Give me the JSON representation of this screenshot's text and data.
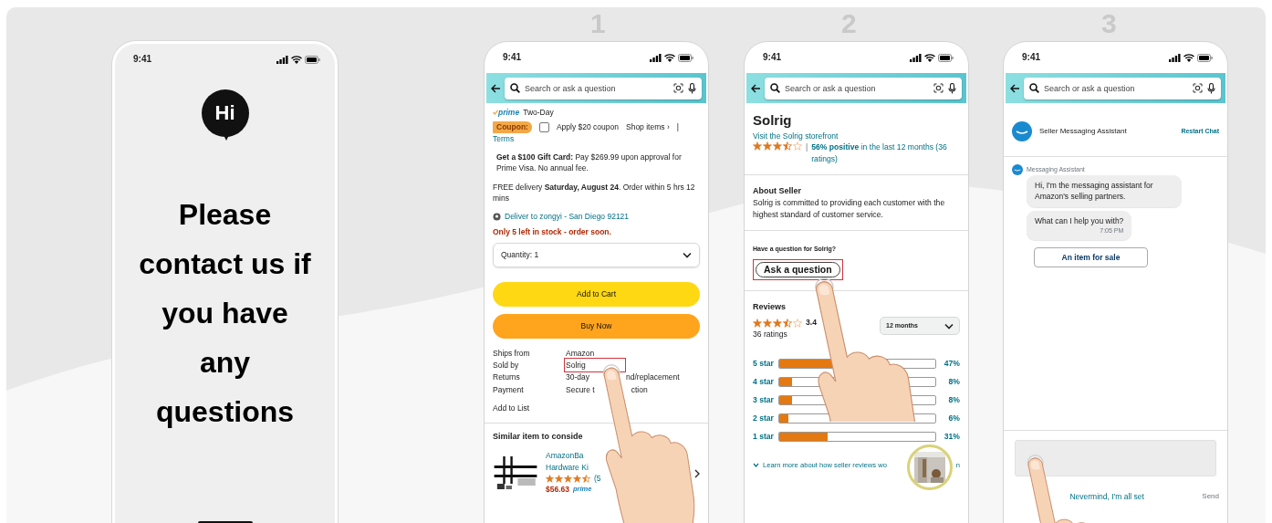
{
  "step_numbers": [
    "1",
    "2",
    "3"
  ],
  "phones": [
    {
      "kind": "message",
      "status_time": "9:41",
      "logo_text": "Hi",
      "message": "Please contact us if you have any questions"
    },
    {
      "kind": "product",
      "status_time": "9:41",
      "search_placeholder": "Search or ask a question",
      "prime_label": "prime",
      "delivery_speed": "Two-Day",
      "coupon": {
        "badge": "Coupon:",
        "checked": false,
        "label": "Apply $20 coupon",
        "link": "Shop items ›",
        "separator": "|",
        "terms": "Terms"
      },
      "gift_card": "**Get a $100 Gift Card:** Pay $269.99 upon approval for Prime Visa. No annual fee.",
      "delivery": "FREE delivery **Saturday, August 24**. Order within 5 hrs 12 mins",
      "deliver_to": "Deliver to zongyi - San Diego 92121",
      "stock": "Only 5 left in stock - order soon.",
      "quantity": "Quantity: 1",
      "buttons": [
        {
          "label": "Add to Cart",
          "kind": "cart"
        },
        {
          "label": "Buy Now",
          "kind": "buy"
        }
      ],
      "details": [
        {
          "label": "Ships from",
          "value": "Amazon",
          "highlighted": false
        },
        {
          "label": "Sold by",
          "value": "Solrig",
          "highlighted": true
        },
        {
          "label": "Returns",
          "value": "30-day",
          "value_tail": "nd/replacement",
          "highlighted": false
        },
        {
          "label": "Payment",
          "value": "Secure t",
          "value_tail": "ction",
          "highlighted": false
        }
      ],
      "add_to_list": "Add to List",
      "similar_heading": "Similar item to conside",
      "similar": {
        "title_lines": [
          "AmazonBa",
          "Hardware Ki"
        ],
        "stars": 4.5,
        "rating_count": "(5",
        "price": "$56.63",
        "prime_label": "prime"
      }
    },
    {
      "kind": "seller",
      "status_time": "9:41",
      "search_placeholder": "Search or ask a question",
      "title": "Solrig",
      "storefront": "Visit the Solrig storefront",
      "stars": 3.5,
      "separator": "|",
      "positive": "**56% positive** in the last 12 months (36 ratings)",
      "about_heading": "About Seller",
      "about": "Solrig is committed to providing each customer with the highest standard of customer service.",
      "question_prompt": "Have a question for Solrig?",
      "ask_button": "Ask a question",
      "ask_highlighted": true,
      "reviews_heading": "Reviews",
      "review": {
        "stars": 3.5
      },
      "rating": "3.4",
      "ratings_count": "36 ratings",
      "period": "12 months",
      "bars": [
        {
          "label": "5 star",
          "level": 0.47,
          "percent": "47%"
        },
        {
          "label": "4 star",
          "level": 0.08,
          "percent": "8%"
        },
        {
          "label": "3 star",
          "level": 0.08,
          "percent": "8%"
        },
        {
          "label": "2 star",
          "level": 0.06,
          "percent": "6%"
        },
        {
          "label": "1 star",
          "level": 0.31,
          "percent": "31%"
        }
      ],
      "learn_more": "Learn more about how seller reviews wo",
      "learn_more_tail": "n"
    },
    {
      "kind": "chat",
      "status_time": "9:41",
      "search_placeholder": "Search or ask a question",
      "assistant_name": "Seller Messaging Assistant",
      "restart": "Restart Chat",
      "sender": "Messaging Assistant",
      "messages": [
        {
          "text": "Hi, I'm the messaging assistant for Amazon's selling partners."
        },
        {
          "text": "What can I help you with?",
          "time": "7:05 PM"
        }
      ],
      "options": [
        "An item for sale"
      ],
      "dismiss": "Nevermind, I'm all set",
      "send": "Send"
    }
  ]
}
